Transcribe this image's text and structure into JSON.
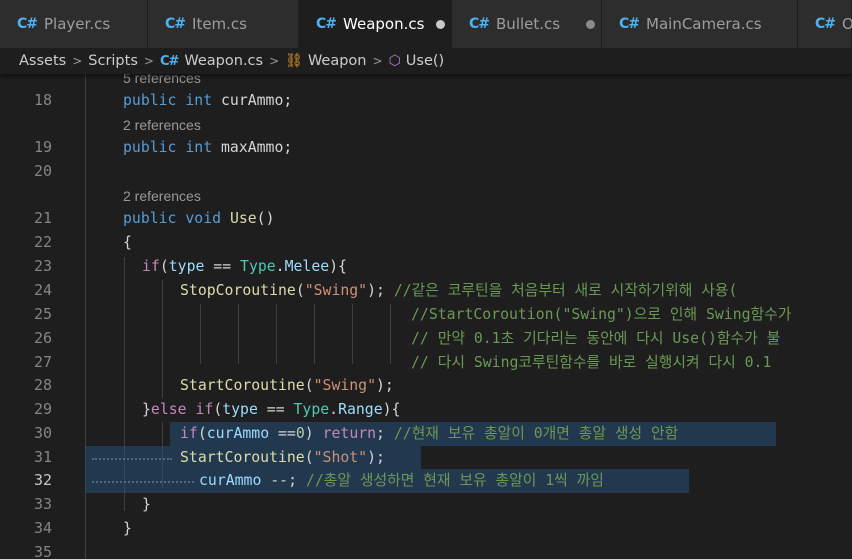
{
  "tabs": [
    {
      "label": "Player.cs",
      "icon": "csharp-icon",
      "active": false,
      "dirty": false
    },
    {
      "label": "Item.cs",
      "icon": "csharp-icon",
      "active": false,
      "dirty": false
    },
    {
      "label": "Weapon.cs",
      "icon": "csharp-icon",
      "active": true,
      "dirty": true
    },
    {
      "label": "Bullet.cs",
      "icon": "csharp-icon",
      "active": false,
      "dirty": true
    },
    {
      "label": "MainCamera.cs",
      "icon": "csharp-icon",
      "active": false,
      "dirty": false
    },
    {
      "label": "Obi",
      "icon": "csharp-icon",
      "active": false,
      "dirty": false
    }
  ],
  "tab_icon_glyph": "C#",
  "breadcrumb": {
    "items": [
      "Assets",
      "Scripts",
      "Weapon.cs",
      "Weapon",
      "Use()"
    ],
    "separator": ">"
  },
  "codelens": {
    "top_partial": "5 references",
    "maxAmmo": "2 references",
    "use": "2 references"
  },
  "lines": {
    "18": {
      "num": "18",
      "t": [
        "public",
        " ",
        "int",
        " curAmmo;"
      ]
    },
    "19": {
      "num": "19",
      "t": [
        "public",
        " ",
        "int",
        " maxAmmo;"
      ]
    },
    "20": {
      "num": "20"
    },
    "21": {
      "num": "21",
      "t": [
        "public",
        " ",
        "void",
        " ",
        "Use",
        "()"
      ]
    },
    "22": {
      "num": "22",
      "t": [
        "{"
      ]
    },
    "23": {
      "num": "23",
      "t": [
        "if",
        "(",
        "type",
        " == ",
        "Type",
        ".",
        "Melee",
        "){"
      ]
    },
    "24": {
      "num": "24",
      "t": [
        "StopCoroutine",
        "(",
        "\"Swing\"",
        "); ",
        "//같은 코루틴을 처음부터 새로 시작하기위해 사용("
      ]
    },
    "25": {
      "num": "25",
      "t": [
        "//StartCoroution(\"Swing\")으로 인해 Swing함수가 "
      ]
    },
    "26": {
      "num": "26",
      "t": [
        "// 만약 0.1초 기다리는 동안에 다시 Use()함수가 불"
      ]
    },
    "27": {
      "num": "27",
      "t": [
        "// 다시 Swing코루틴함수를 바로 실행시켜 다시 0.1"
      ]
    },
    "28": {
      "num": "28",
      "t": [
        "StartCoroutine",
        "(",
        "\"Swing\"",
        ");"
      ]
    },
    "29": {
      "num": "29",
      "t": [
        "}",
        "else",
        " ",
        "if",
        "(",
        "type",
        " == ",
        "Type",
        ".",
        "Range",
        "){"
      ]
    },
    "30": {
      "num": "30",
      "t": [
        "if",
        "(",
        "curAmmo",
        " ==",
        "0",
        ") ",
        "return",
        "; ",
        "//현재 보유 총알이 0개면 총알 생성 안함"
      ]
    },
    "31": {
      "num": "31",
      "t": [
        "StartCoroutine",
        "(",
        "\"Shot\"",
        ");"
      ]
    },
    "32": {
      "num": "32",
      "t": [
        "curAmmo",
        " --; ",
        "//총알 생성하면 현재 보유 총알이 1씩 까임"
      ]
    },
    "33": {
      "num": "33",
      "t": [
        "}"
      ]
    },
    "34": {
      "num": "34",
      "t": [
        "}"
      ]
    },
    "35": {
      "num": "35"
    }
  },
  "current_line": "32",
  "theme": {
    "keyword": "#569cd6",
    "control": "#c586c0",
    "function": "#dcdcaa",
    "string": "#ce9178",
    "number": "#b5cea8",
    "comment": "#6a9955",
    "type": "#4ec9b0",
    "variable": "#9cdcfe",
    "selection": "#264f78",
    "background": "#1e1e1e"
  }
}
